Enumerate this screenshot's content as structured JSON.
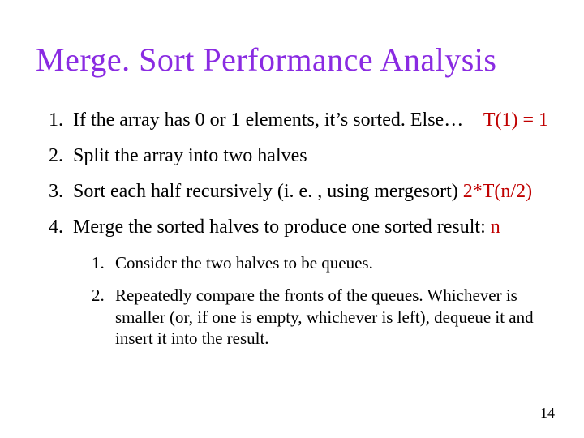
{
  "title": "Merge. Sort Performance Analysis",
  "items": {
    "i1": {
      "text": "If the array has 0 or 1 elements, it’s sorted.  Else…",
      "annot": "T(1) = 1"
    },
    "i2": {
      "text": "Split the array into two halves"
    },
    "i3": {
      "text": "Sort each half recursively (i. e. , using mergesort) ",
      "annot": "2*T(n/2)"
    },
    "i4": {
      "text": "Merge the sorted halves to produce one sorted result:  ",
      "annot": "n",
      "sub": {
        "s1": "Consider the two halves to be queues.",
        "s2": "Repeatedly compare the fronts of the queues.  Whichever is smaller (or, if one is empty, whichever is left), dequeue it and insert it into the result."
      }
    }
  },
  "page": "14"
}
